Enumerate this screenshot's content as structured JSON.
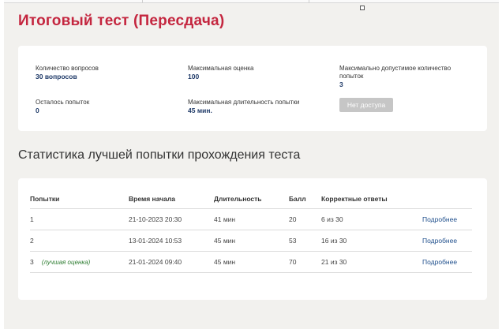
{
  "page": {
    "title": "Итоговый тест (Пересдача)"
  },
  "info": {
    "questions_label": "Количество вопросов",
    "questions_value": "30 вопросов",
    "max_score_label": "Максимальная оценка",
    "max_score_value": "100",
    "max_attempts_label_line1": "Максимально допустимое количество",
    "max_attempts_label_line2": "попыток",
    "max_attempts_value": "3",
    "remaining_label": "Осталось попыток",
    "remaining_value": "0",
    "max_duration_label": "Максимальная длительность попытки",
    "max_duration_value": "45 мин.",
    "no_access_button": "Нет доступа"
  },
  "stats": {
    "title": "Статистика лучшей попытки прохождения теста",
    "columns": [
      "Попытки",
      "Время начала",
      "Длительность",
      "Балл",
      "Корректные ответы"
    ],
    "rows": [
      {
        "attempt": "1",
        "note": "",
        "start": "21-10-2023 20:30",
        "duration": "41 мин",
        "score": "20",
        "correct": "6 из 30",
        "link": "Подробнее"
      },
      {
        "attempt": "2",
        "note": "",
        "start": "13-01-2024 10:53",
        "duration": "45 мин",
        "score": "53",
        "correct": "16 из 30",
        "link": "Подробнее"
      },
      {
        "attempt": "3",
        "note": "(лучшая оценка)",
        "start": "21-01-2024 09:40",
        "duration": "45 мин",
        "score": "70",
        "correct": "21 из 30",
        "link": "Подробнее"
      }
    ]
  },
  "colors": {
    "title": "#c4263f",
    "value": "#1f3a68",
    "link": "#1f4f8c",
    "best_note": "#2e7d32",
    "background": "#f2f1ee"
  }
}
